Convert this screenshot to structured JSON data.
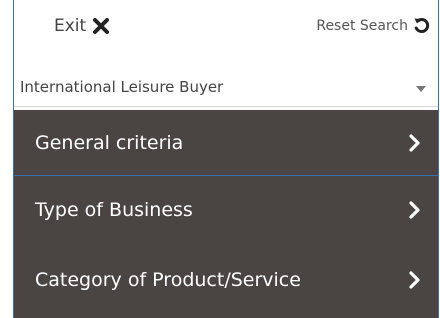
{
  "topbar": {
    "exit_label": "Exit",
    "exit_icon": "close-x-icon",
    "reset_label": "Reset Search",
    "reset_icon": "reset-arrow-icon"
  },
  "buyer_select": {
    "selected": "International Leisure Buyer"
  },
  "menu": {
    "items": [
      {
        "label": "General criteria",
        "icon": "chevron-right-icon"
      },
      {
        "label": "Type of Business",
        "icon": "chevron-right-icon"
      },
      {
        "label": "Category of Product/Service",
        "icon": "chevron-right-icon"
      }
    ]
  },
  "colors": {
    "menu_background": "#4a4443",
    "menu_text": "#ffffff",
    "accent_border": "#3a6fa8",
    "icon_dark": "#222222"
  }
}
